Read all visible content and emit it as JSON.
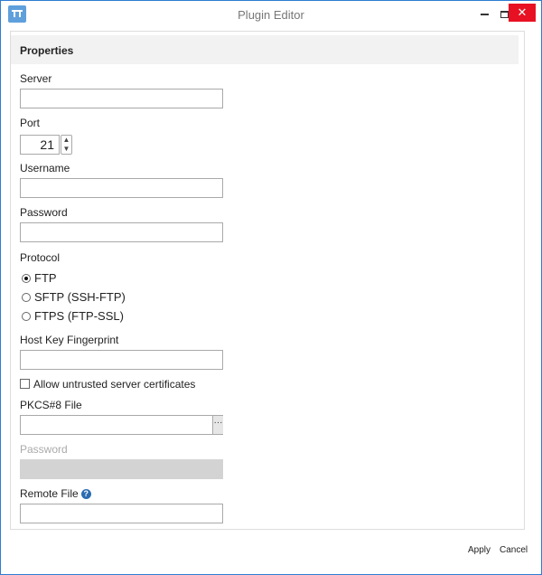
{
  "window": {
    "title": "Plugin Editor",
    "controls": {
      "minimize": "",
      "maximize": "",
      "close": "✕"
    }
  },
  "properties": {
    "header": "Properties",
    "server": {
      "label": "Server",
      "value": ""
    },
    "port": {
      "label": "Port",
      "value": "21"
    },
    "username": {
      "label": "Username",
      "value": ""
    },
    "password": {
      "label": "Password",
      "value": ""
    },
    "protocol": {
      "label": "Protocol",
      "options": [
        {
          "label": "FTP",
          "checked": true
        },
        {
          "label": "SFTP (SSH-FTP)",
          "checked": false
        },
        {
          "label": "FTPS (FTP-SSL)",
          "checked": false
        }
      ]
    },
    "host_key": {
      "label": "Host Key Fingerprint",
      "value": ""
    },
    "allow_untrusted": {
      "label": "Allow untrusted server certificates",
      "checked": false
    },
    "pkcs8": {
      "label": "PKCS#8 File",
      "value": "",
      "browse": "···"
    },
    "pkcs_password": {
      "label": "Password",
      "value": "",
      "disabled": true
    },
    "remote_file": {
      "label": "Remote File",
      "help": "?",
      "value": ""
    }
  },
  "footer": {
    "apply": "Apply",
    "cancel": "Cancel"
  }
}
